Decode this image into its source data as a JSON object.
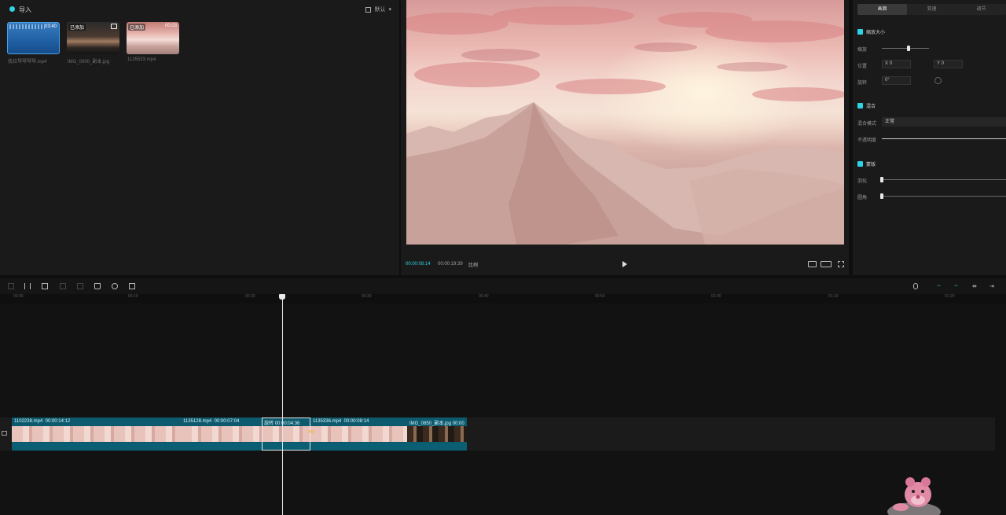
{
  "media": {
    "import_label": "导入",
    "sort_label": "默认",
    "items": [
      {
        "name": "我拉琴琴琴琴.mp4",
        "duration": "03:40",
        "tag": ""
      },
      {
        "name": "IMG_0000_副本.jpg",
        "duration": "",
        "tag": "已添加"
      },
      {
        "name": "1135533.mp4",
        "duration": "00:03",
        "tag": "已添加"
      }
    ]
  },
  "player": {
    "current_time": "00:00:08:14",
    "total_time": "00:00:19:39",
    "ratio": "比例"
  },
  "inspector": {
    "tabs": [
      "画面",
      "变速",
      "调节"
    ],
    "sections": {
      "size": "缩放大小",
      "blend": "混合",
      "mask": "蒙版"
    },
    "labels": {
      "scale": "缩放",
      "position": "位置",
      "rotate": "旋转",
      "blend_mode": "混合模式",
      "opacity": "不透明度",
      "feather": "羽化",
      "round": "圆角"
    },
    "position_x_label": "X",
    "position_x": "0",
    "position_y_label": "Y",
    "position_y": "0",
    "rotate_value": "0°",
    "blend_mode_value": "正常"
  },
  "ruler": [
    "00:00",
    "00:10",
    "00:20",
    "00:30",
    "00:40",
    "00:50",
    "01:00",
    "01:10",
    "01:20"
  ],
  "timeline": {
    "clips": [
      {
        "name": "1102238.mp4",
        "duration": "00:00:14:12"
      },
      {
        "name": "1135128.mp4",
        "duration": "00:00:07:04"
      },
      {
        "name": "旋转",
        "duration": "00:00:04:36"
      },
      {
        "name": "1135336.mp4",
        "duration": "00:00:08:14"
      },
      {
        "name": "IMG_0850_副本.jpg",
        "duration": "00:00"
      }
    ]
  }
}
